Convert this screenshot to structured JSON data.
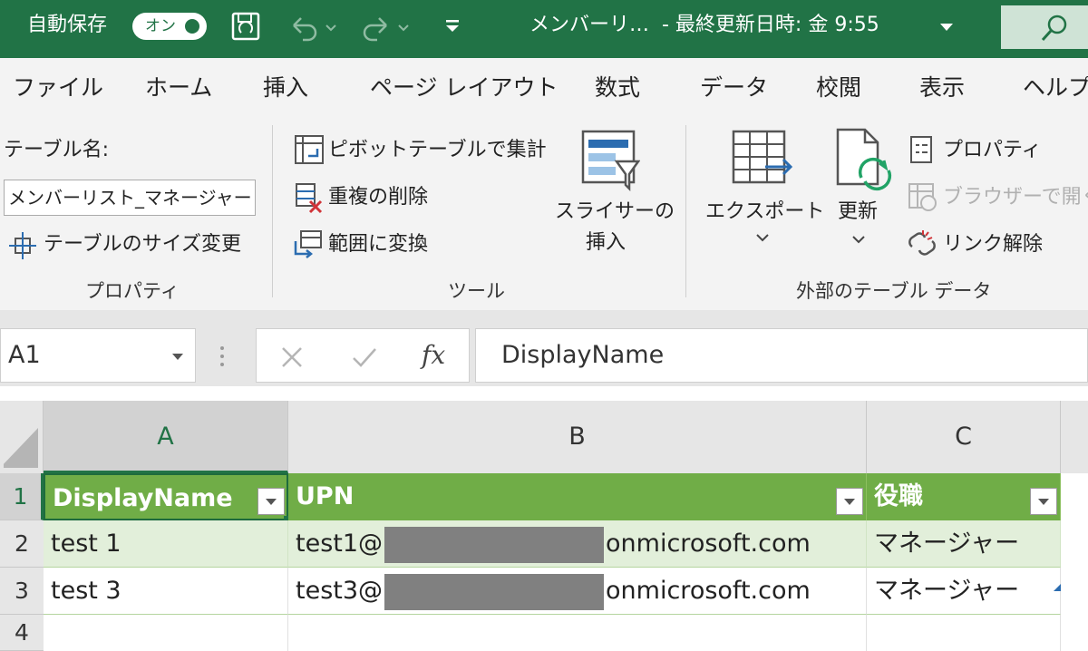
{
  "titlebar": {
    "autosave_label": "自動保存",
    "autosave_state": "オン",
    "doc_title": "メンバーリ…",
    "modified": "- 最終更新日時: 金 9:55"
  },
  "tabs": [
    "ファイル",
    "ホーム",
    "挿入",
    "ページ レイアウト",
    "数式",
    "データ",
    "校閲",
    "表示",
    "ヘルプ"
  ],
  "ribbon": {
    "properties": {
      "table_name_label": "テーブル名:",
      "table_name_value": "メンバーリスト_マネージャー",
      "resize_label": "テーブルのサイズ変更",
      "group_label": "プロパティ"
    },
    "tools": {
      "pivot_label": "ピボットテーブルで集計",
      "remove_dup_label": "重複の削除",
      "convert_label": "範囲に変換",
      "slicer_label_1": "スライサーの",
      "slicer_label_2": "挿入",
      "group_label": "ツール"
    },
    "external": {
      "export_label": "エクスポート",
      "refresh_label": "更新",
      "properties_label": "プロパティ",
      "browser_label": "ブラウザーで開く",
      "unlink_label": "リンク解除",
      "group_label": "外部のテーブル データ"
    }
  },
  "formula_bar": {
    "name_box": "A1",
    "fx": "fx",
    "formula": "DisplayName"
  },
  "grid": {
    "columns": [
      "A",
      "B",
      "C"
    ],
    "rows": [
      "1",
      "2",
      "3",
      "4"
    ],
    "header": [
      "DisplayName",
      "UPN",
      "役職"
    ],
    "data": [
      {
        "name": "test 1",
        "upn_prefix": "test1@",
        "upn_suffix": "onmicrosoft.com",
        "role": "マネージャー"
      },
      {
        "name": "test 3",
        "upn_prefix": "test3@",
        "upn_suffix": "onmicrosoft.com",
        "role": "マネージャー"
      }
    ]
  },
  "colors": {
    "titlebar": "#217346",
    "table_header": "#70ad47",
    "band": "#e2efda"
  }
}
